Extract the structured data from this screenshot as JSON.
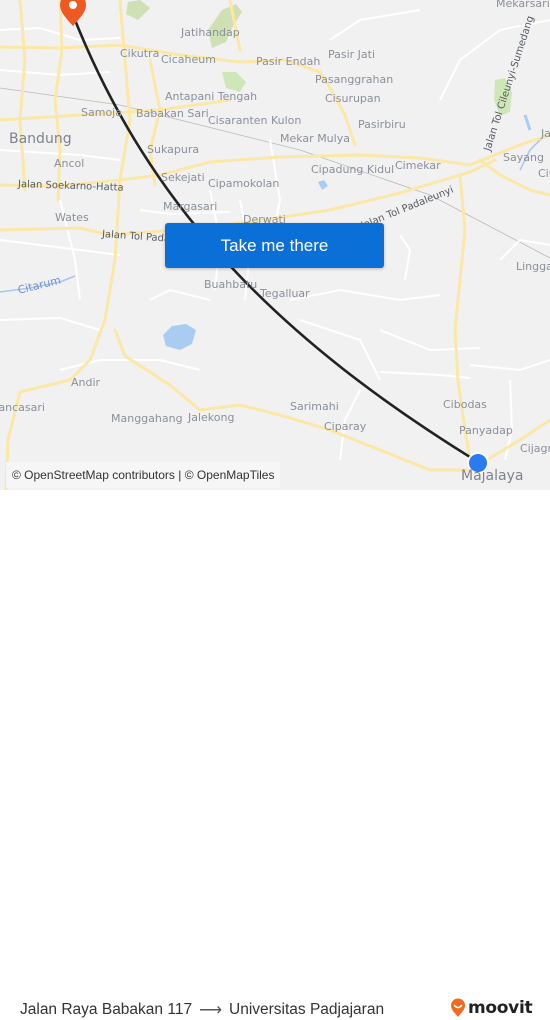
{
  "map": {
    "places": [
      {
        "name": "Mekarsari",
        "cls": "place"
      },
      {
        "name": "Jatihandap",
        "cls": "place"
      },
      {
        "name": "Cikutra",
        "cls": "place"
      },
      {
        "name": "Cicaheum",
        "cls": "place"
      },
      {
        "name": "Pasir Endah",
        "cls": "place"
      },
      {
        "name": "Pasir Jati",
        "cls": "place"
      },
      {
        "name": "Pasanggrahan",
        "cls": "place"
      },
      {
        "name": "Antapani Tengah",
        "cls": "place"
      },
      {
        "name": "Cisurupan",
        "cls": "place"
      },
      {
        "name": "Samoja",
        "cls": "place"
      },
      {
        "name": "Babakan Sari",
        "cls": "place"
      },
      {
        "name": "Cisaranten Kulon",
        "cls": "place"
      },
      {
        "name": "Pasirbiru",
        "cls": "place"
      },
      {
        "name": "Bandung",
        "cls": "place big"
      },
      {
        "name": "Mekar Mulya",
        "cls": "place"
      },
      {
        "name": "Sukapura",
        "cls": "place"
      },
      {
        "name": "Ancol",
        "cls": "place"
      },
      {
        "name": "Cipadung Kidul",
        "cls": "place"
      },
      {
        "name": "Cimekar",
        "cls": "place"
      },
      {
        "name": "Sayang",
        "cls": "place"
      },
      {
        "name": "Sekejati",
        "cls": "place"
      },
      {
        "name": "Cipamokolan",
        "cls": "place"
      },
      {
        "name": "Margasari",
        "cls": "place"
      },
      {
        "name": "Wates",
        "cls": "place"
      },
      {
        "name": "Derwati",
        "cls": "place"
      },
      {
        "name": "Linggar",
        "cls": "place"
      },
      {
        "name": "Buahbatu",
        "cls": "place"
      },
      {
        "name": "Tegalluar",
        "cls": "place"
      },
      {
        "name": "Andir",
        "cls": "place"
      },
      {
        "name": "Rancasari",
        "cls": "place"
      },
      {
        "name": "Manggahang",
        "cls": "place"
      },
      {
        "name": "Jalekong",
        "cls": "place"
      },
      {
        "name": "Sarimahi",
        "cls": "place"
      },
      {
        "name": "Ciparay",
        "cls": "place"
      },
      {
        "name": "Cibodas",
        "cls": "place"
      },
      {
        "name": "Panyadap",
        "cls": "place"
      },
      {
        "name": "Cijagra",
        "cls": "place"
      },
      {
        "name": "Majalaya",
        "cls": "place big"
      },
      {
        "name": "Cis",
        "cls": "place"
      },
      {
        "name": "Ja",
        "cls": "place"
      }
    ],
    "roads": [
      {
        "name": "Jalan Soekarno-Hatta"
      },
      {
        "name": "Jalan Tol Padaleunyi"
      },
      {
        "name": "Jalan Tol Padaleunyi"
      },
      {
        "name": "Jalan Tol Cileunyi-Sumedang"
      }
    ],
    "rivers": [
      {
        "name": "Citarum"
      }
    ],
    "origin_marker": {
      "color": "#2a7af0"
    },
    "destination_marker": {
      "color": "#f05a22"
    },
    "route_line_color": "#222222"
  },
  "cta": {
    "label": "Take me there",
    "color": "#0a6fd6"
  },
  "attribution": "© OpenStreetMap contributors | © OpenMapTiles",
  "footer": {
    "origin": "Jalan Raya Babakan 117",
    "arrow": "⟶",
    "destination": "Universitas Padjajaran",
    "brand": "moovit",
    "brand_color": "#f26b21"
  }
}
